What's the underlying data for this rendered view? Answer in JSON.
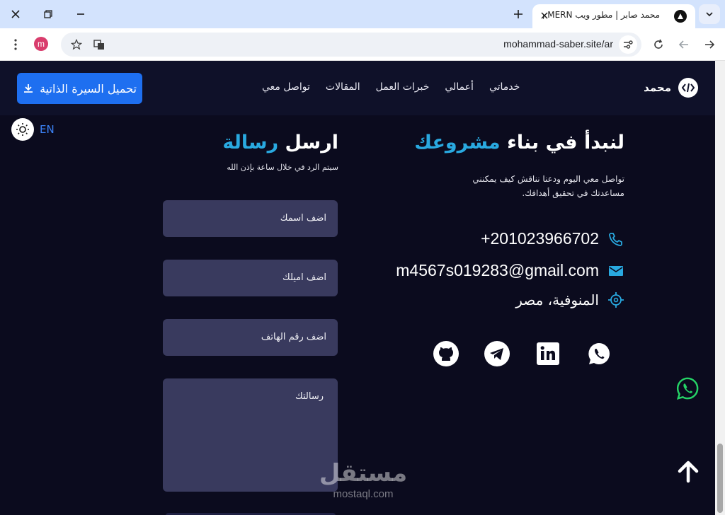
{
  "browser": {
    "tab_title": "محمد صابر | مطور ويب MERN و",
    "url": "mohammad-saber.site/ar",
    "profile_initial": "m"
  },
  "nav": {
    "brand": "محمد",
    "links": [
      "خدماتي",
      "أعمالي",
      "خبرات العمل",
      "المقالات",
      "تواصل معي"
    ],
    "cv_button": "تحميل السيرة الذاتية"
  },
  "lang_toggle": "EN",
  "contact": {
    "title_prefix": "لنبدأ في بناء",
    "title_accent": "مشروعك",
    "description": "تواصل معي اليوم ودعنا نناقش كيف يمكنني مساعدتك في تحقيق أهدافك.",
    "phone": "+201023966702",
    "email": "m4567s019283@gmail.com",
    "location": "المنوفية، مصر",
    "socials": [
      "whatsapp-icon",
      "linkedin-icon",
      "telegram-icon",
      "github-icon"
    ]
  },
  "form": {
    "title_prefix": "ارسل",
    "title_accent": "رسالة",
    "subtitle": "سيتم الرد في خلال ساعة بإذن الله",
    "name_placeholder": "اضف اسمك",
    "email_placeholder": "اضف اميلك",
    "phone_placeholder": "اضف رقم الهاتف",
    "message_placeholder": "رسالتك"
  },
  "watermark": {
    "arabic": "مستقل",
    "latin": "mostaql.com"
  },
  "colors": {
    "accent": "#29a9e0",
    "button": "#1e6ff0",
    "background": "#0b0b1e",
    "field": "#393a5e",
    "whatsapp": "#25d366"
  }
}
